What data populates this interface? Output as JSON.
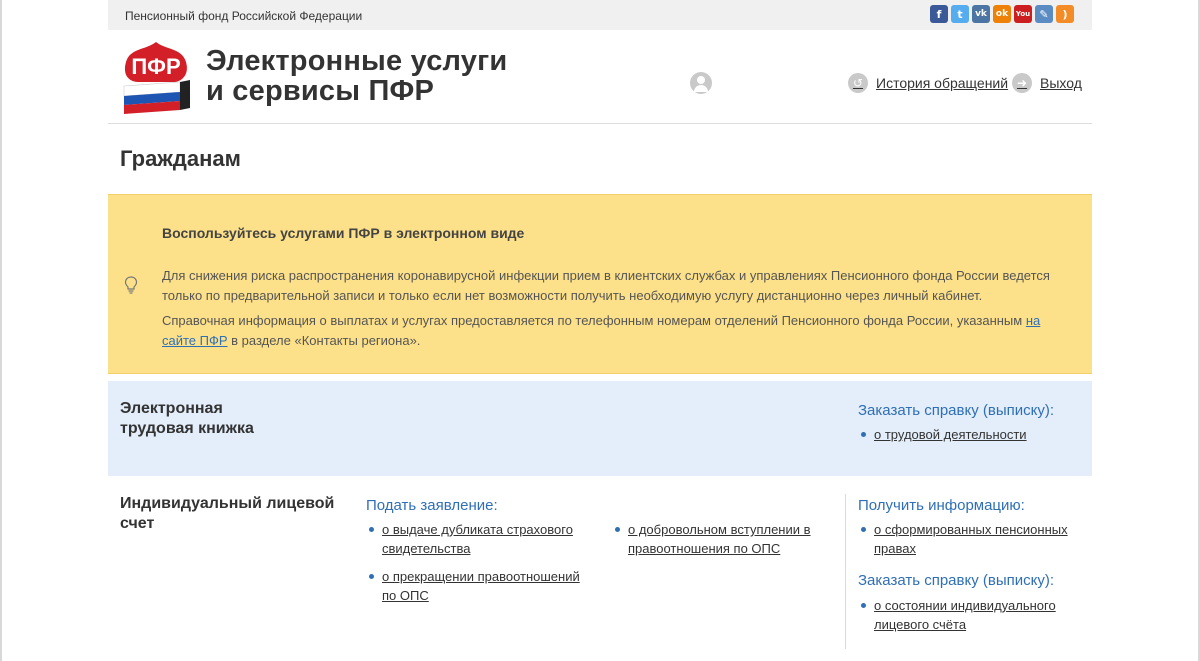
{
  "topbar": {
    "org": "Пенсионный фонд Российской Федерации",
    "social": [
      {
        "icon": "facebook-icon",
        "glyph": "f",
        "color": "#3b5998"
      },
      {
        "icon": "twitter-icon",
        "glyph": "t",
        "color": "#55acee"
      },
      {
        "icon": "vk-icon",
        "glyph": "vk",
        "color": "#4c75a3"
      },
      {
        "icon": "odnoklassniki-icon",
        "glyph": "ok",
        "color": "#ee8208"
      },
      {
        "icon": "youtube-icon",
        "glyph": "You",
        "color": "#cc2020"
      },
      {
        "icon": "livejournal-icon",
        "glyph": "✎",
        "color": "#5a8bc2"
      },
      {
        "icon": "rss-icon",
        "glyph": ")",
        "color": "#f38b26"
      }
    ]
  },
  "header": {
    "title_line1": "Электронные услуги",
    "title_line2": "и сервисы ПФР",
    "history_label": "История обращений",
    "logout_label": "Выход"
  },
  "page_title": "Гражданам",
  "notice": {
    "title": "Воспользуйтесь услугами ПФР в электронном виде",
    "text1": "Для снижения риска распространения коронавирусной инфекции прием в клиентских службах и управлениях Пенсионного фонда России ведется только по предварительной записи и только если нет возможности получить необходимую услугу дистанционно через личный кабинет.",
    "text2_before": "Справочная информация о выплатах и услугах предоставляется по телефонным номерам отделений Пенсионного фонда России, указанным ",
    "text2_link": "на сайте ПФР",
    "text2_after": " в разделе «Контакты региона»."
  },
  "etk": {
    "title_line1": "Электронная",
    "title_line2": "трудовая книжка",
    "order_title": "Заказать справку (выписку):",
    "items": [
      "о трудовой деятельности"
    ]
  },
  "ils": {
    "title_line1": "Индивидуальный лицевой",
    "title_line2": "счет",
    "apply_title": "Подать заявление:",
    "apply_col1": [
      "о выдаче дубликата страхового свидетельства",
      "о прекращении правоотношений по ОПС"
    ],
    "apply_col2": [
      "о добровольном вступлении в правоотношения по ОПС"
    ],
    "info_title": "Получить информацию:",
    "info_items": [
      "о сформированных пенсионных правах"
    ],
    "order_title": "Заказать справку (выписку):",
    "order_items": [
      "о состоянии индивидуального лицевого счёта"
    ]
  },
  "colors": {
    "notice_bg": "#fde18a",
    "etk_bg": "#e3eefa",
    "link_blue": "#2f6fb6"
  }
}
